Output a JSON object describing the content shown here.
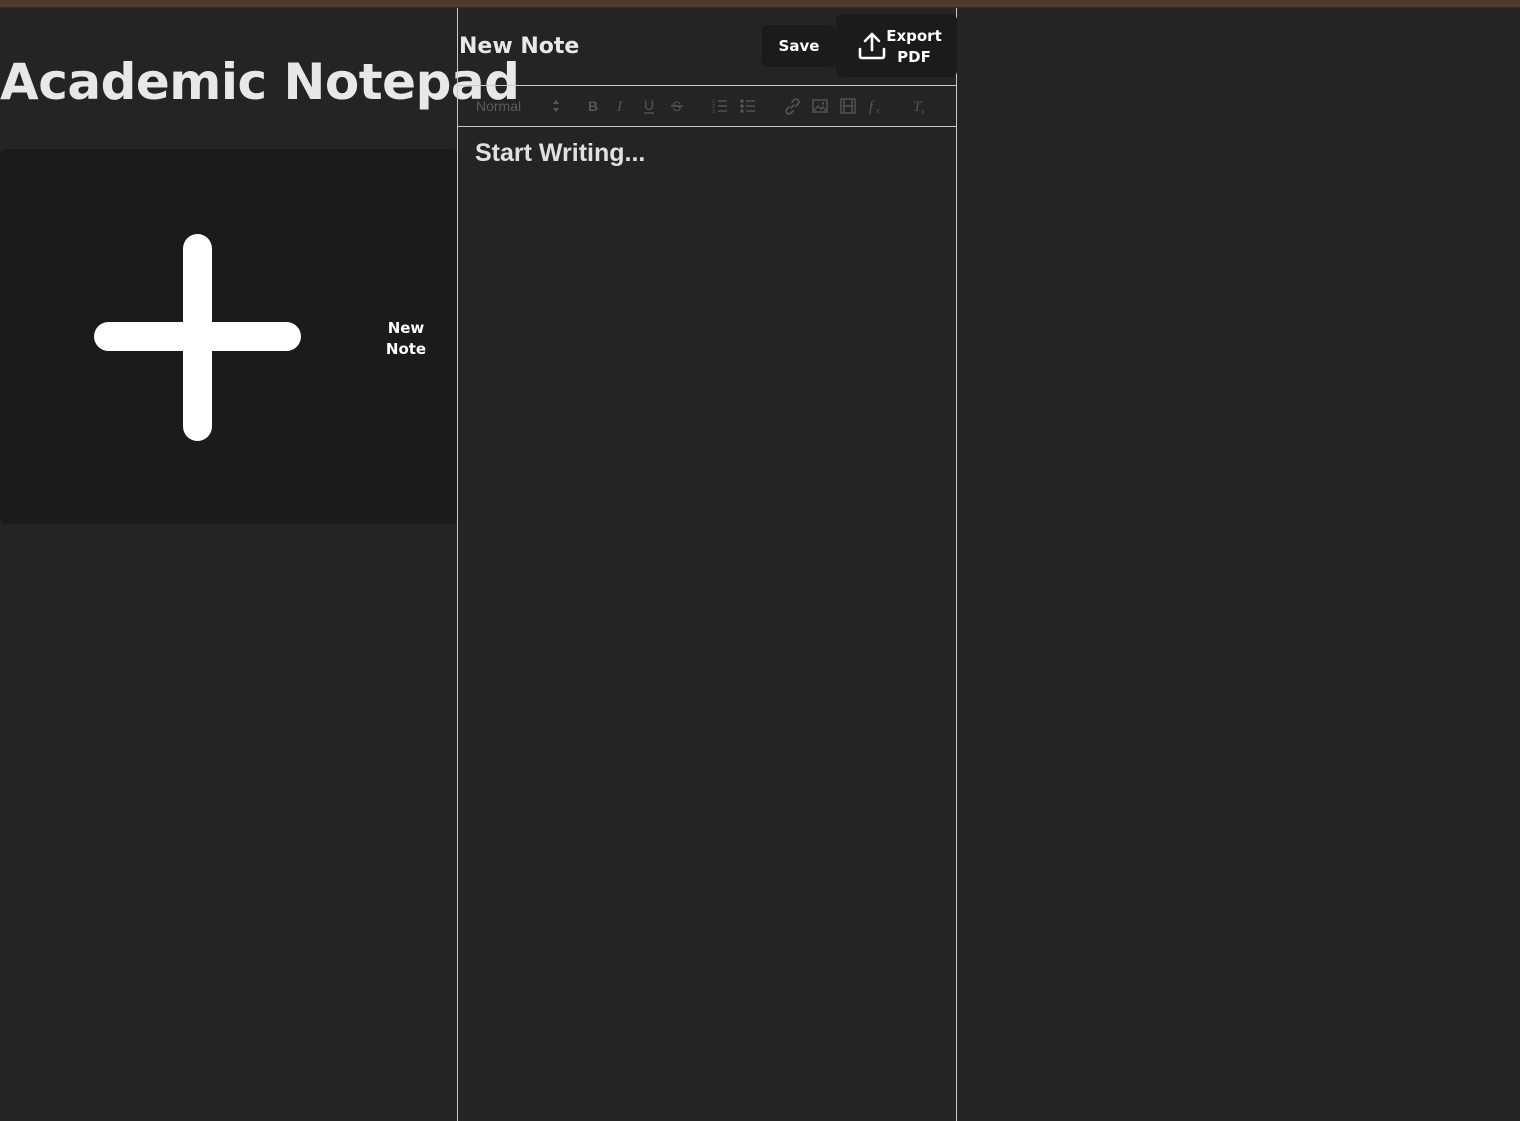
{
  "app": {
    "title": "Academic Notepad"
  },
  "sidebar": {
    "new_note_card": {
      "label": "New Note",
      "icon": "plus-icon"
    }
  },
  "editor": {
    "note_title": "New Note",
    "save_label": "Save",
    "export_label": "Export PDF",
    "export_icon": "upload-icon",
    "placeholder": "Start Writing...",
    "toolbar": {
      "format_select_value": "Normal",
      "buttons": [
        "bold-icon",
        "italic-icon",
        "underline-icon",
        "strikethrough-icon",
        "ordered-list-icon",
        "bullet-list-icon",
        "link-icon",
        "image-icon",
        "video-icon",
        "formula-icon",
        "clear-format-icon"
      ]
    }
  },
  "colors": {
    "background": "#242424",
    "card": "#1b1b1b",
    "top_bar": "#4e3a2c",
    "text": "#e8e8e8",
    "toolbar_icon": "#555555"
  }
}
